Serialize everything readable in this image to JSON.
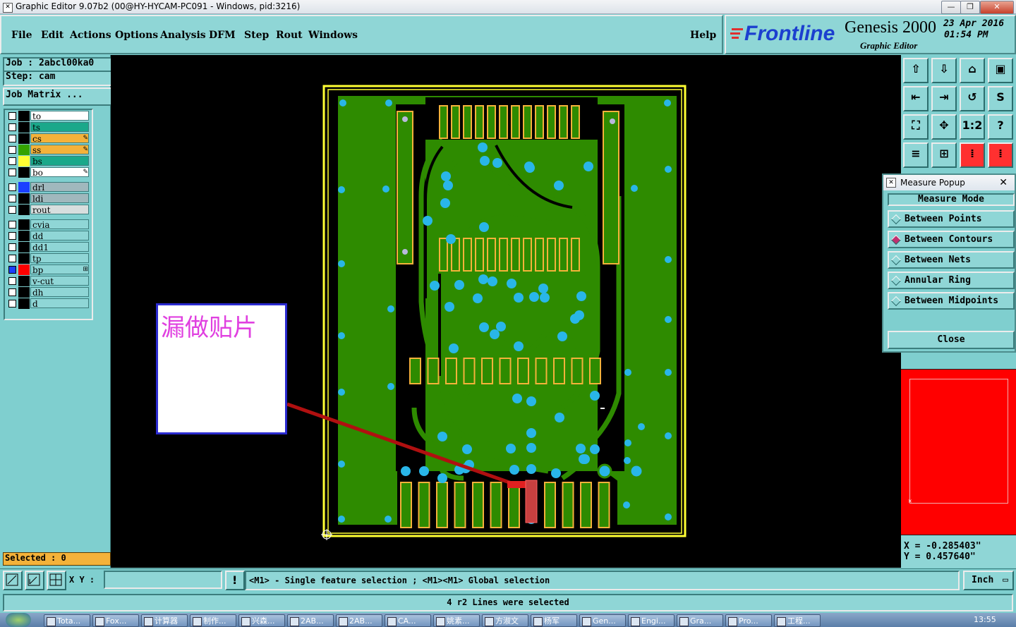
{
  "window": {
    "title": "Graphic Editor 9.07b2 (00@HY-HYCAM-PC091 - Windows, pid:3216)",
    "minimize_glyph": "—",
    "maximize_glyph": "❐",
    "close_glyph": "✕"
  },
  "menu": {
    "items": [
      "File",
      "Edit",
      "Actions",
      "Options",
      "Analysis",
      "DFM",
      "Step",
      "Rout",
      "Windows"
    ],
    "help": "Help"
  },
  "logo": {
    "brand": "Frontline",
    "product": "Genesis 2000",
    "subtitle": "Graphic Editor",
    "date": "23 Apr 2016",
    "time": "01:54 PM",
    "brand_color": "#1b3fcf"
  },
  "job_panel": {
    "job": "Job : 2abcl00ka0",
    "step": "Step: cam",
    "matrix_button": "Job Matrix ..."
  },
  "layers": [
    {
      "name": "to",
      "color": "#ffffff",
      "swatch": "#000000",
      "mark": ""
    },
    {
      "name": "ts",
      "color": "#1aa88a",
      "swatch": "#000000",
      "mark": ""
    },
    {
      "name": "cs",
      "color": "#f4b23a",
      "swatch": "#000000",
      "mark": "✎"
    },
    {
      "name": "ss",
      "color": "#f4b23a",
      "swatch": "#35a300",
      "mark": "✎"
    },
    {
      "name": "bs",
      "color": "#1aa88a",
      "swatch": "#ffff33",
      "mark": ""
    },
    {
      "name": "bo",
      "color": "#ffffff",
      "swatch": "#000000",
      "mark": "✎"
    },
    {
      "name": "drl",
      "color": "#a0b8bd",
      "swatch": "#1b3fff",
      "mark": ""
    },
    {
      "name": "ldi",
      "color": "#a0b8bd",
      "swatch": "#000000",
      "mark": ""
    },
    {
      "name": "rout",
      "color": "#d7dede",
      "swatch": "#000000",
      "mark": ""
    },
    {
      "name": "cvia",
      "color": "#8fd6d6",
      "swatch": "#000000",
      "mark": ""
    },
    {
      "name": "dd",
      "color": "#8fd6d6",
      "swatch": "#000000",
      "mark": ""
    },
    {
      "name": "dd1",
      "color": "#8fd6d6",
      "swatch": "#000000",
      "mark": ""
    },
    {
      "name": "tp",
      "color": "#8fd6d6",
      "swatch": "#000000",
      "mark": ""
    },
    {
      "name": "bp",
      "color": "#8fd6d6",
      "swatch": "#ff0000",
      "mark": "⊞"
    },
    {
      "name": "v-cut",
      "color": "#8fd6d6",
      "swatch": "#000000",
      "mark": ""
    },
    {
      "name": "dh",
      "color": "#8fd6d6",
      "swatch": "#000000",
      "mark": ""
    },
    {
      "name": "d",
      "color": "#8fd6d6",
      "swatch": "#000000",
      "mark": ""
    }
  ],
  "selected_label": "Selected : 0",
  "annotation": {
    "text": "漏做贴片",
    "text_color": "#e040e0"
  },
  "measure_popup": {
    "title": "Measure Popup",
    "mode_header": "Measure Mode",
    "options": [
      {
        "label": "Between Points",
        "selected": false
      },
      {
        "label": "Between Contours",
        "selected": true
      },
      {
        "label": "Between Nets",
        "selected": false
      },
      {
        "label": "Annular Ring",
        "selected": false
      },
      {
        "label": "Between Midpoints",
        "selected": false
      }
    ],
    "close_label": "Close"
  },
  "coordinates": {
    "x": "X = -0.285403\"",
    "y": "Y = 0.457640\""
  },
  "bottom": {
    "xy_label": "X Y :",
    "xy_value": "",
    "hint": "<M1> - Single feature selection ; <M1><M1> Global selection",
    "unit": "Inch"
  },
  "status_message": "4 r2 Lines were selected",
  "taskbar": {
    "items": [
      "Tota...",
      "Fox...",
      "计算器",
      "制作...",
      "兴森...",
      "2AB...",
      "2AB...",
      "CA...",
      "姚素...",
      "方淑文",
      "杨军",
      "Gen...",
      "Engi...",
      "Gra...",
      "Pro...",
      "工程..."
    ],
    "clock": "13:55"
  }
}
